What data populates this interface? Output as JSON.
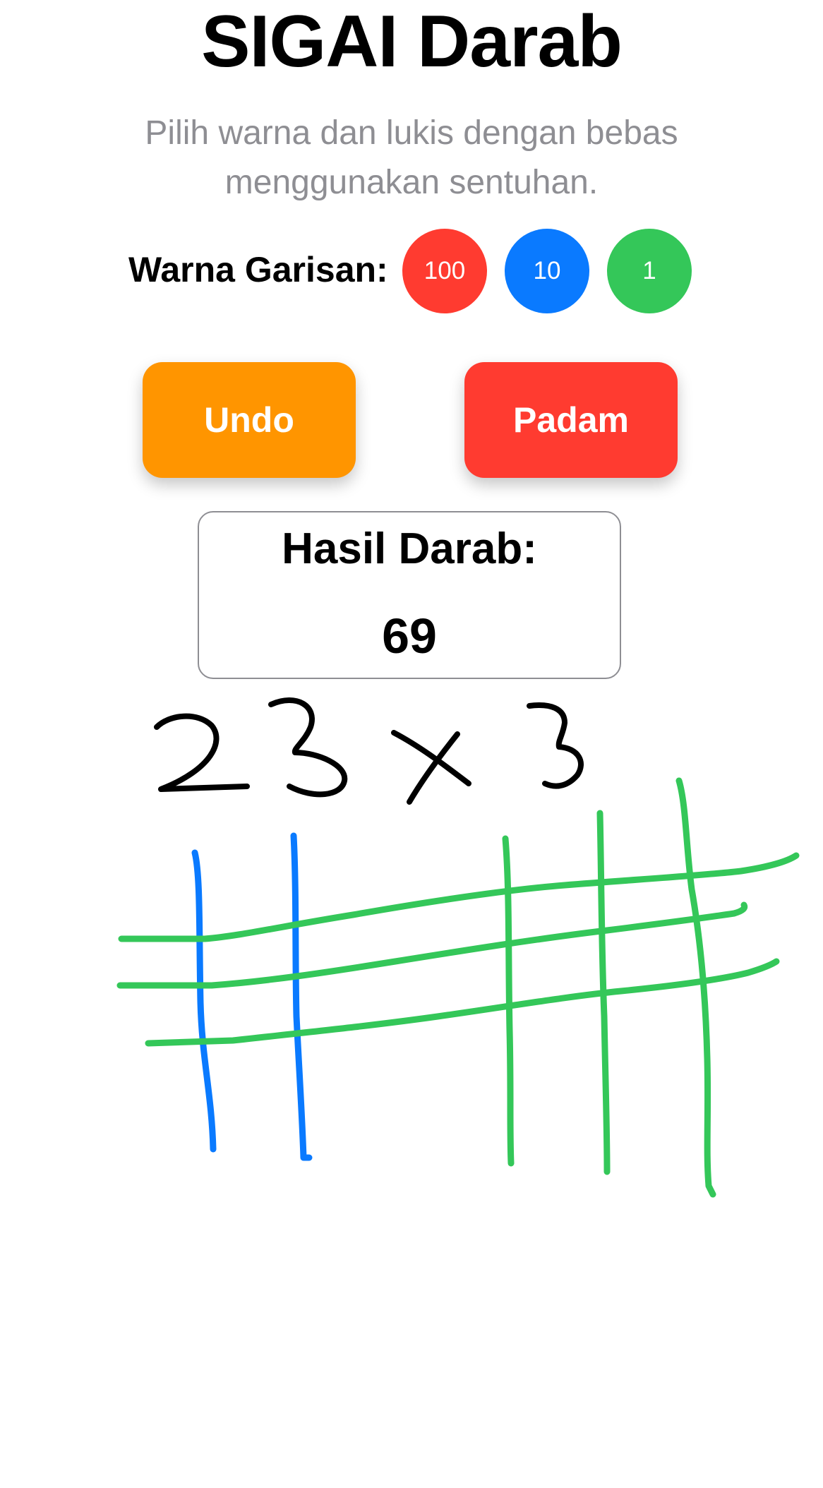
{
  "app": {
    "title": "SIGAI Darab",
    "subtitle": "Pilih warna dan lukis dengan bebas menggunakan sentuhan."
  },
  "colors": {
    "label": "Warna Garisan:",
    "swatches": [
      {
        "value": "100",
        "color": "#ff3b30"
      },
      {
        "value": "10",
        "color": "#0a7aff"
      },
      {
        "value": "1",
        "color": "#34c759"
      }
    ]
  },
  "buttons": {
    "undo": "Undo",
    "clear": "Padam"
  },
  "result": {
    "label": "Hasil Darab:",
    "value": "69"
  },
  "canvas": {
    "handwritten_text": "23 × 3",
    "stroke_colors": {
      "ink": "#000000",
      "tens": "#0a7aff",
      "ones": "#34c759"
    }
  }
}
